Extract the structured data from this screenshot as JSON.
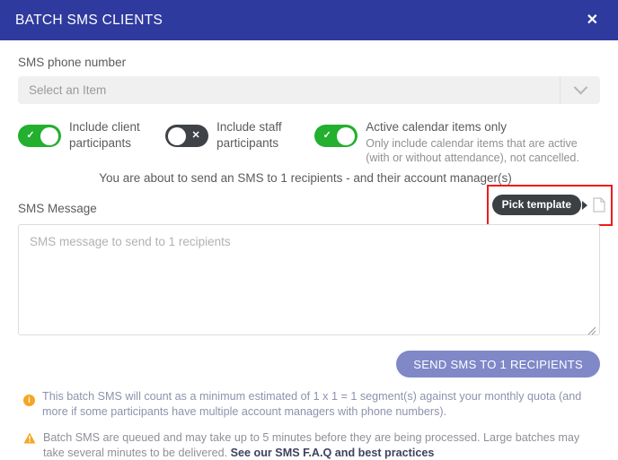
{
  "header": {
    "title": "BATCH SMS CLIENTS",
    "close_label": "✕"
  },
  "phone_field": {
    "label": "SMS phone number",
    "selected_value": "Select an Item",
    "chevron_icon": "chevron-down-icon"
  },
  "toggles": [
    {
      "label": "Include client participants",
      "state": "on",
      "mark": "✓"
    },
    {
      "label": "Include staff participants",
      "state": "off",
      "mark": "✕"
    },
    {
      "label": "Active calendar items only",
      "sub": "Only include calendar items that are active (with or without attendance), not cancelled.",
      "state": "on",
      "mark": "✓"
    }
  ],
  "recipients_note": "You are about to send an SMS to 1 recipients - and their account manager(s)",
  "message": {
    "label": "SMS Message",
    "placeholder": "SMS message to send to 1 recipients",
    "value": "",
    "template_tooltip": "Pick template",
    "template_icon": "document-icon",
    "highlight_color": "#ee1b1b"
  },
  "send_button": {
    "label": "SEND SMS TO 1 RECIPIENTS",
    "color": "#8088c8"
  },
  "notes": [
    {
      "icon": "info-icon",
      "icon_color": "#f5a623",
      "text": "This batch SMS will count as a minimum estimated of 1 x 1 = 1 segment(s) against your monthly quota (and more if some participants have multiple account managers with phone numbers)."
    },
    {
      "icon": "warning-triangle-icon",
      "icon_color": "#f5a623",
      "text_before": "Batch SMS are queued and may take up to 5 minutes before they are being processed. Large batches may take several minutes to be delivered. ",
      "link_text": "See our SMS F.A.Q and best practices"
    }
  ],
  "theme": {
    "header_bg": "#2f3a9e",
    "toggle_on": "#22b02e",
    "toggle_off": "#3f4246",
    "tooltip_bg": "#3c4043"
  }
}
